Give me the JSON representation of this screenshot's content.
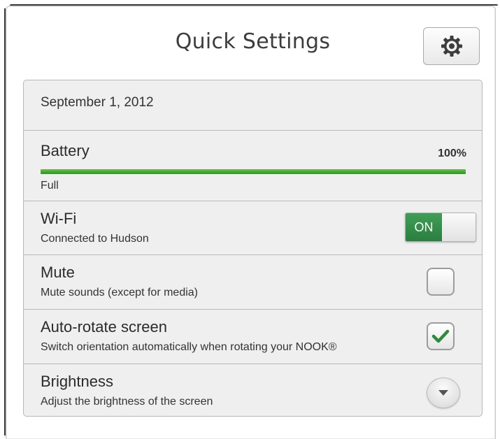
{
  "header": {
    "title": "Quick Settings",
    "settings_icon": "gear-icon"
  },
  "date": {
    "label": "September 1, 2012"
  },
  "battery": {
    "title": "Battery",
    "percent_label": "100%",
    "level": 1.0,
    "status": "Full",
    "bar_color": "#3a9a34"
  },
  "wifi": {
    "title": "Wi-Fi",
    "subtitle": "Connected to Hudson",
    "toggle_label": "ON",
    "toggle_state": "on",
    "toggle_color": "#2f8a45"
  },
  "mute": {
    "title": "Mute",
    "subtitle": "Mute sounds (except for media)",
    "checked": false
  },
  "auto_rotate": {
    "title": "Auto-rotate screen",
    "subtitle": "Switch orientation automatically when rotating your NOOK®",
    "checked": true
  },
  "brightness": {
    "title": "Brightness",
    "subtitle": "Adjust the brightness of the screen",
    "expand_icon": "chevron-down-icon"
  }
}
